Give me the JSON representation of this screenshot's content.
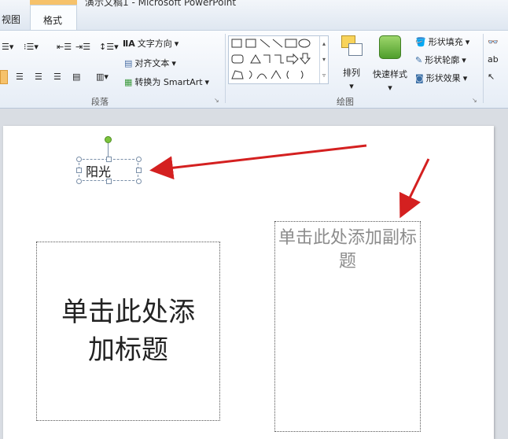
{
  "window": {
    "title": "演示文稿1 - Microsoft PowerPoint"
  },
  "tabs": {
    "view": "视图",
    "format": "格式"
  },
  "paragraph_group": {
    "label": "段落",
    "text_direction": "文字方向",
    "align_text": "对齐文本",
    "convert_smartart": "转换为 SmartArt"
  },
  "drawing_group": {
    "label": "绘图",
    "arrange": "排列",
    "quick_styles": "快速样式",
    "shape_fill": "形状填充",
    "shape_outline": "形状轮廓",
    "shape_effects": "形状效果"
  },
  "slide": {
    "textbox_text": "阳光",
    "title_placeholder": "单击此处添加标题",
    "subtitle_placeholder": "单击此处添加副标题"
  },
  "colors": {
    "arrow": "#d42020",
    "handle_green": "#7cc43c",
    "accent_tab": "#f6c26b"
  }
}
